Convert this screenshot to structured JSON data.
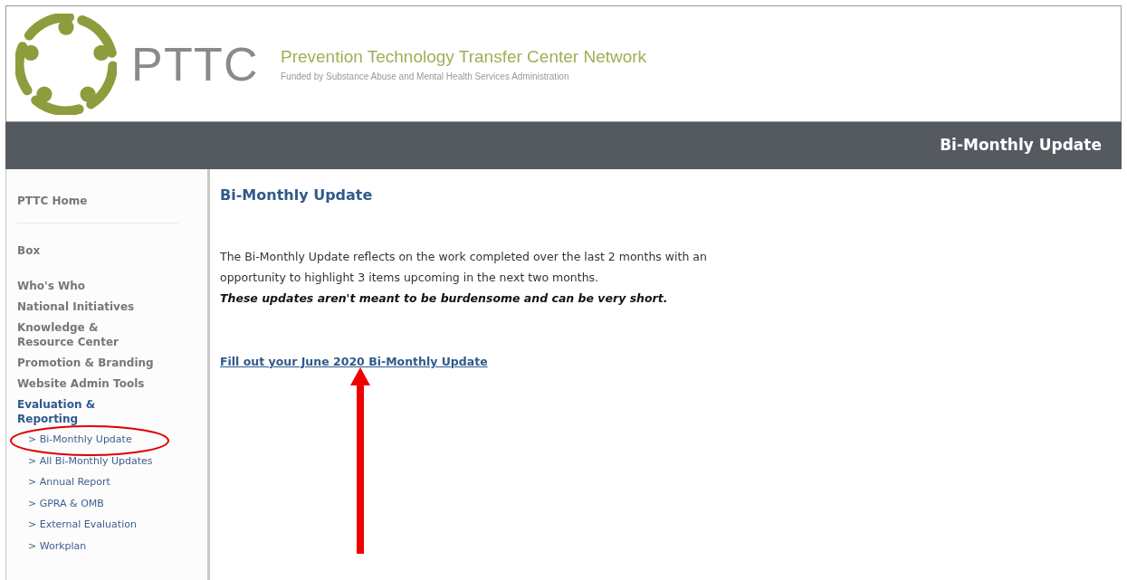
{
  "header": {
    "logo_text": "PTTC",
    "network_name": "Prevention Technology Transfer Center Network",
    "funded_by": "Funded by Substance Abuse and Mental Health Services Administration"
  },
  "banner": {
    "title": "Bi-Monthly Update"
  },
  "sidebar": {
    "items": [
      {
        "label": "PTTC Home",
        "selected": false,
        "divider_after": true
      },
      {
        "label": "Box",
        "selected": false
      },
      {
        "label": "Who's Who",
        "selected": false
      },
      {
        "label": "National Initiatives",
        "selected": false
      },
      {
        "label": "Knowledge & Resource Center",
        "selected": false
      },
      {
        "label": "Promotion & Branding",
        "selected": false
      },
      {
        "label": "Website Admin Tools",
        "selected": false
      },
      {
        "label": "Evaluation & Reporting",
        "selected": true,
        "children": [
          {
            "label": "> Bi-Monthly Update",
            "circled": true
          },
          {
            "label": "> All Bi-Monthly Updates",
            "circled": false
          },
          {
            "label": "> Annual Report",
            "circled": false
          },
          {
            "label": "> GPRA & OMB",
            "circled": false
          },
          {
            "label": "> External Evaluation",
            "circled": false
          },
          {
            "label": "> Workplan",
            "circled": false
          }
        ]
      }
    ]
  },
  "content": {
    "heading": "Bi-Monthly Update",
    "paragraph": "The Bi-Monthly Update reflects on the work completed over the last 2 months with an opportunity to highlight 3 items upcoming in the next two months.",
    "emphasis": "These updates aren't meant to be burdensome and can be very short.",
    "link": "Fill out your June 2020 Bi-Monthly Update",
    "arrow_to_link": true
  }
}
